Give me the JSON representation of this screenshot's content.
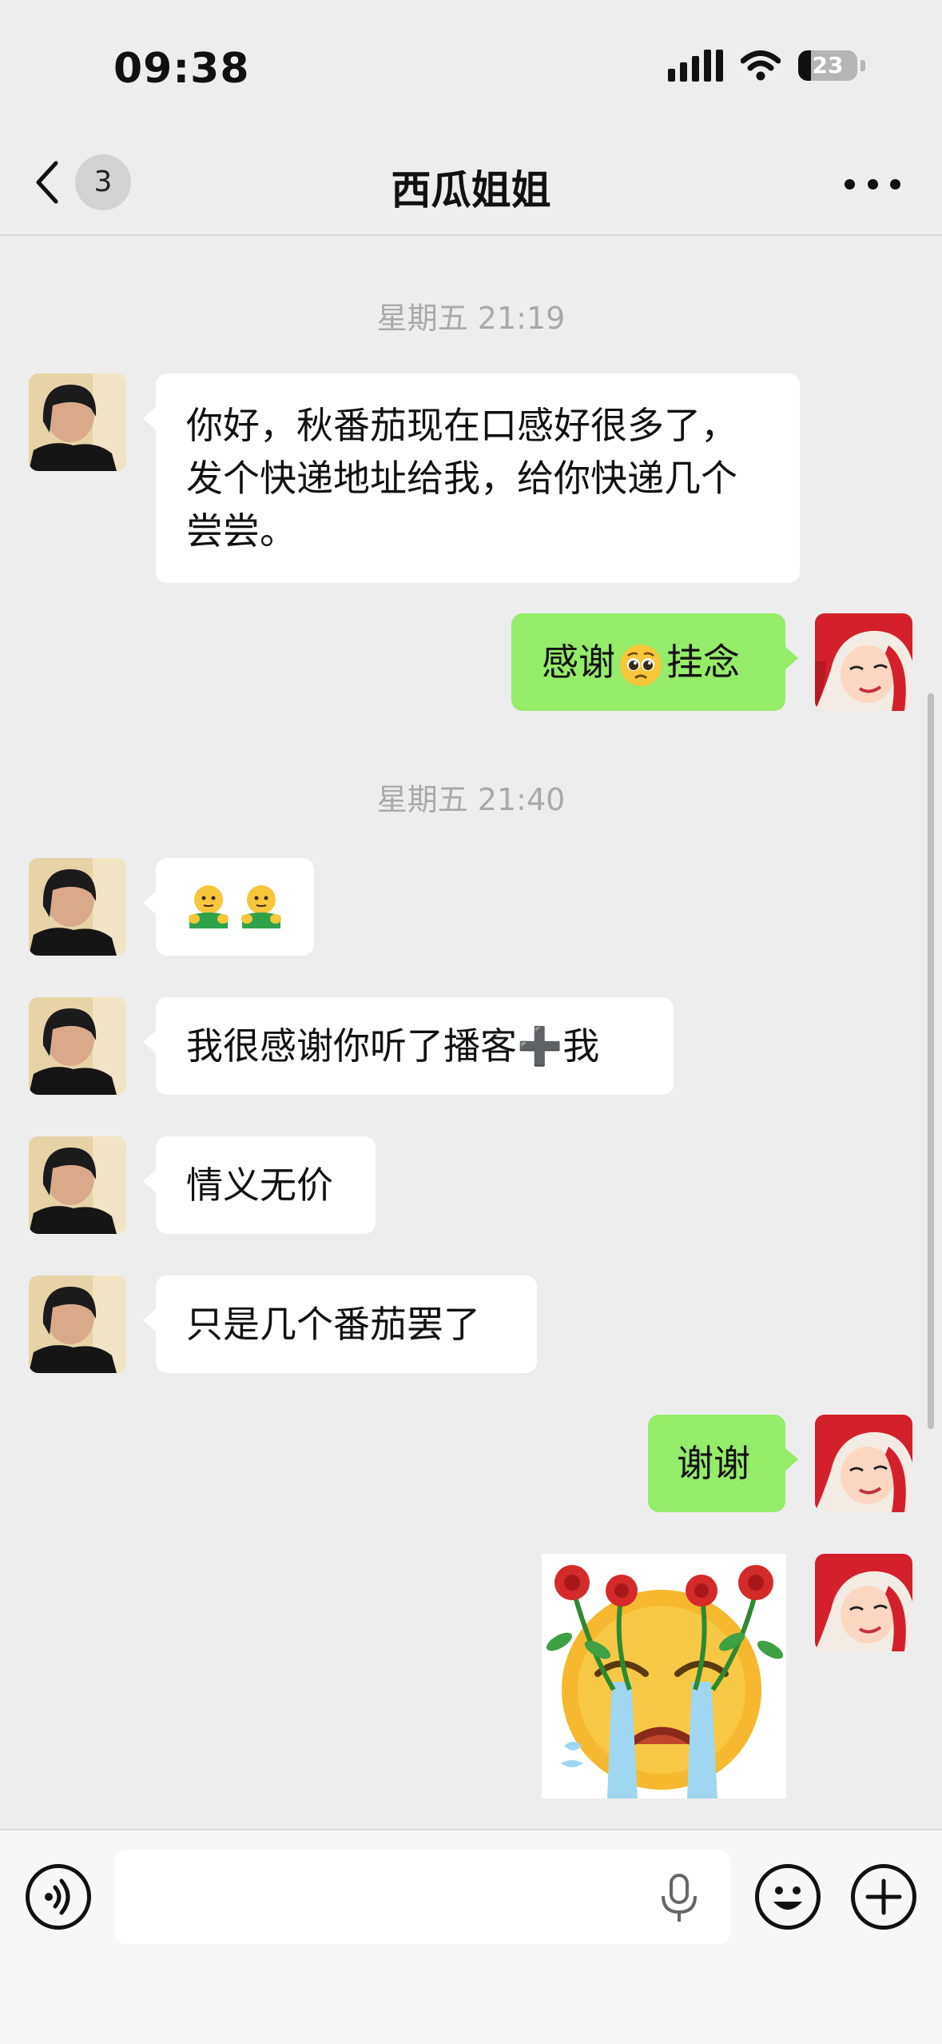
{
  "status_bar": {
    "time": "09:38",
    "battery": "23"
  },
  "nav": {
    "back_badge": "3",
    "title": "西瓜姐姐"
  },
  "chat": {
    "timestamps": [
      "星期五 21:19",
      "星期五 21:40"
    ],
    "messages": [
      {
        "side": "in",
        "text": "你好，秋番茄现在口感好很多了，发个快递地址给我，给你快递几个尝尝。"
      },
      {
        "side": "out",
        "text_before": "感谢",
        "emoji": "pleading-face-emoji",
        "text_after": "挂念"
      },
      {
        "side": "in",
        "sticker": "hug-emoji-pair"
      },
      {
        "side": "in",
        "text": "我很感谢你听了播客➕我"
      },
      {
        "side": "in",
        "text": "情义无价"
      },
      {
        "side": "in",
        "text": "只是几个番茄罢了"
      },
      {
        "side": "out",
        "text": "谢谢"
      },
      {
        "side": "out",
        "sticker": "crying-face-with-roses-sticker"
      }
    ]
  },
  "input_bar": {
    "placeholder": ""
  }
}
